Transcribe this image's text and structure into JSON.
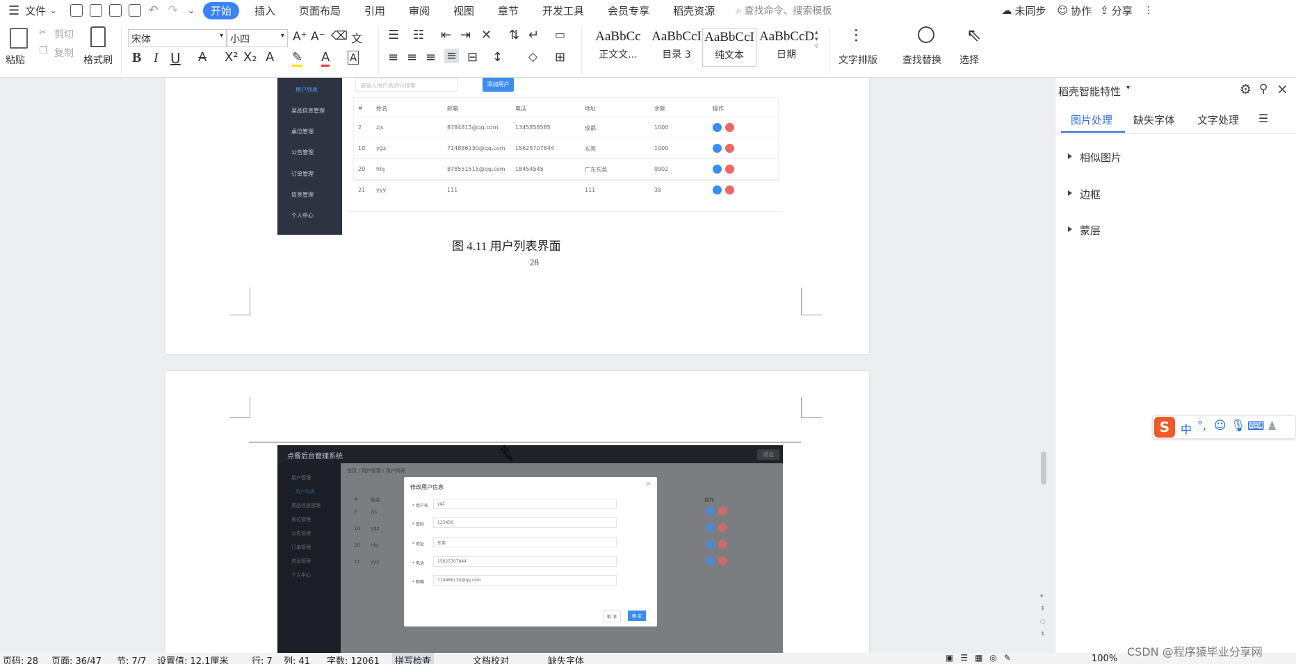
{
  "menubar": {
    "file": "文件",
    "tabs": [
      "开始",
      "插入",
      "页面布局",
      "引用",
      "审阅",
      "视图",
      "章节",
      "开发工具",
      "会员专享",
      "稻壳资源"
    ],
    "search_placeholder": "查找命令、搜索模板",
    "sync": "未同步",
    "collab": "协作",
    "share": "分享"
  },
  "ribbon": {
    "paste": "粘贴",
    "cut": "剪切",
    "copy": "复制",
    "format_painter": "格式刷",
    "font_name": "宋体",
    "font_size": "小四",
    "styles": [
      {
        "preview": "AaBbCc",
        "label": "正文文..."
      },
      {
        "preview": "AaBbCcI",
        "label": "目录 3"
      },
      {
        "preview": "AaBbCcI",
        "label": "纯文本"
      },
      {
        "preview": "AaBbCcDc",
        "label": "日期"
      }
    ],
    "text_layout": "文字排版",
    "find_replace": "查找替换",
    "select": "选择"
  },
  "document": {
    "figure_caption": "图 4.11 用户列表界面",
    "page_number": "28",
    "list_screenshot": {
      "nav_active": "用户列表",
      "nav_items": [
        "菜品信息管理",
        "桌位管理",
        "公告管理",
        "订单管理",
        "信息管理",
        "个人中心"
      ],
      "search_placeholder": "请输入用户名进行搜索",
      "add_button": "添加用户",
      "columns": [
        "#",
        "姓名",
        "邮箱",
        "电话",
        "地址",
        "余额",
        "操作"
      ],
      "rows": [
        [
          "2",
          "zjs",
          "8784815@qq.com",
          "1345858585",
          "成都",
          "1000"
        ],
        [
          "10",
          "ygz",
          "714886130@qq.com",
          "15625707844",
          "东莞",
          "1000"
        ],
        [
          "20",
          "hlq",
          "878551515@qq.com",
          "18454545",
          "广东东莞",
          "9902"
        ],
        [
          "21",
          "yyy",
          "111",
          "",
          "111",
          "35"
        ]
      ]
    },
    "edit_screenshot": {
      "system_title": "点餐后台管理系统",
      "logout": "退出",
      "breadcrumb": [
        "首页",
        "用户管理",
        "用户列表"
      ],
      "nav_items": [
        "用户管理",
        "用户列表",
        "菜品信息管理",
        "桌位管理",
        "公告管理",
        "订单管理",
        "信息管理",
        "个人中心"
      ],
      "modal_title": "修改用户信息",
      "fields": [
        {
          "label": "* 用户名",
          "value": "ygz"
        },
        {
          "label": "* 密码",
          "value": "123456"
        },
        {
          "label": "* 地址",
          "value": "东莞"
        },
        {
          "label": "* 电话",
          "value": "15625707844"
        },
        {
          "label": "* 邮箱",
          "value": "714886130@qq.com"
        }
      ],
      "cancel": "取 消",
      "confirm": "确 定",
      "bg_rows": [
        "2",
        "10",
        "20",
        "21"
      ],
      "bg_names": [
        "zjs",
        "ygz",
        "hlq",
        "yyy"
      ],
      "bg_col_hash": "#",
      "bg_col_name": "姓名",
      "bg_col_op": "操作"
    }
  },
  "panel": {
    "title": "稻壳智能特性",
    "tabs": [
      "图片处理",
      "缺失字体",
      "文字处理"
    ],
    "items": [
      "相似图片",
      "边框",
      "蒙层"
    ]
  },
  "status": {
    "page": "页码: 28",
    "pages": "页面: 36/47",
    "section": "节: 7/7",
    "setting": "设置值: 12.1厘米",
    "row": "行: 7",
    "col": "列: 41",
    "words": "字数: 12061",
    "spell": "拼写检查",
    "proof": "文档校对",
    "missing_font": "缺失字体",
    "zoom": "100%"
  },
  "watermark": "CSDN @程序猿毕业分享网",
  "colors": {
    "accent": "#3b82f6",
    "sidebar_dark": "#2d3340"
  }
}
